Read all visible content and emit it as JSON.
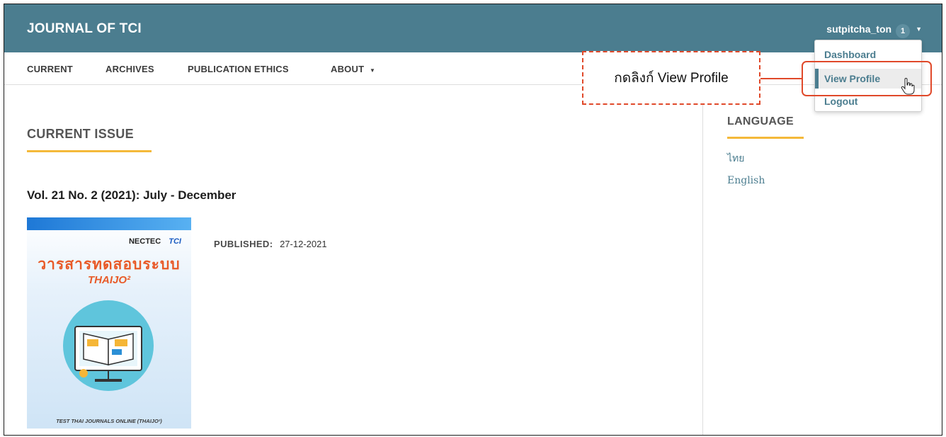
{
  "header": {
    "site_title": "JOURNAL OF TCI",
    "username": "sutpitcha_ton",
    "notification_count": "1"
  },
  "nav": {
    "items": [
      "CURRENT",
      "ARCHIVES",
      "PUBLICATION ETHICS",
      "ABOUT"
    ]
  },
  "main": {
    "section_title": "CURRENT ISSUE",
    "issue_title": "Vol. 21 No. 2 (2021): July - December",
    "published_label": "PUBLISHED:",
    "published_date": "27-12-2021",
    "cover": {
      "logo_left": "NECTEC",
      "logo_right": "TCI",
      "title": "วารสารทดสอบระบบ",
      "subtitle": "THAIJO²",
      "footer": "TEST THAI JOURNALS ONLINE (THAIJO²)"
    }
  },
  "sidebar": {
    "language_heading": "LANGUAGE",
    "languages": [
      "ไทย",
      "English"
    ]
  },
  "user_dropdown": {
    "items": [
      "Dashboard",
      "View Profile",
      "Logout"
    ],
    "active_item": "View Profile"
  },
  "annotation": {
    "callout_text": "กดลิงก์ View Profile",
    "color": "#e0492a"
  },
  "colors": {
    "header_bg": "#4b7d8f",
    "accent_underline": "#f4b93a",
    "link": "#4b7d8f"
  }
}
